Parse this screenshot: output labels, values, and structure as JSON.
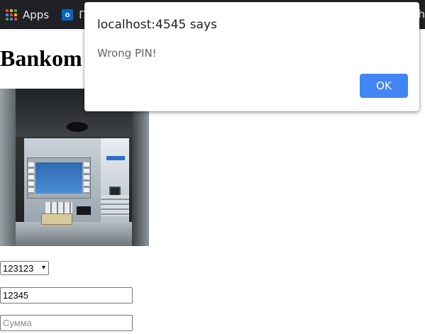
{
  "bookmarks_bar": {
    "apps_label": "Apps",
    "outlook_label": "П",
    "right_fragment": "h",
    "apps_icon": "apps-grid-icon",
    "outlook_icon": "outlook-icon"
  },
  "page": {
    "title": "Bankom",
    "atm_image": "atm-image",
    "card_select": {
      "value": "123123",
      "chevron": "▾"
    },
    "pin_input": {
      "value": "12345"
    },
    "amount_input": {
      "placeholder": "Сумма"
    }
  },
  "dialog": {
    "title": "localhost:4545 says",
    "message": "Wrong PIN!",
    "ok_label": "OK",
    "ok_color": "#4285f4"
  }
}
